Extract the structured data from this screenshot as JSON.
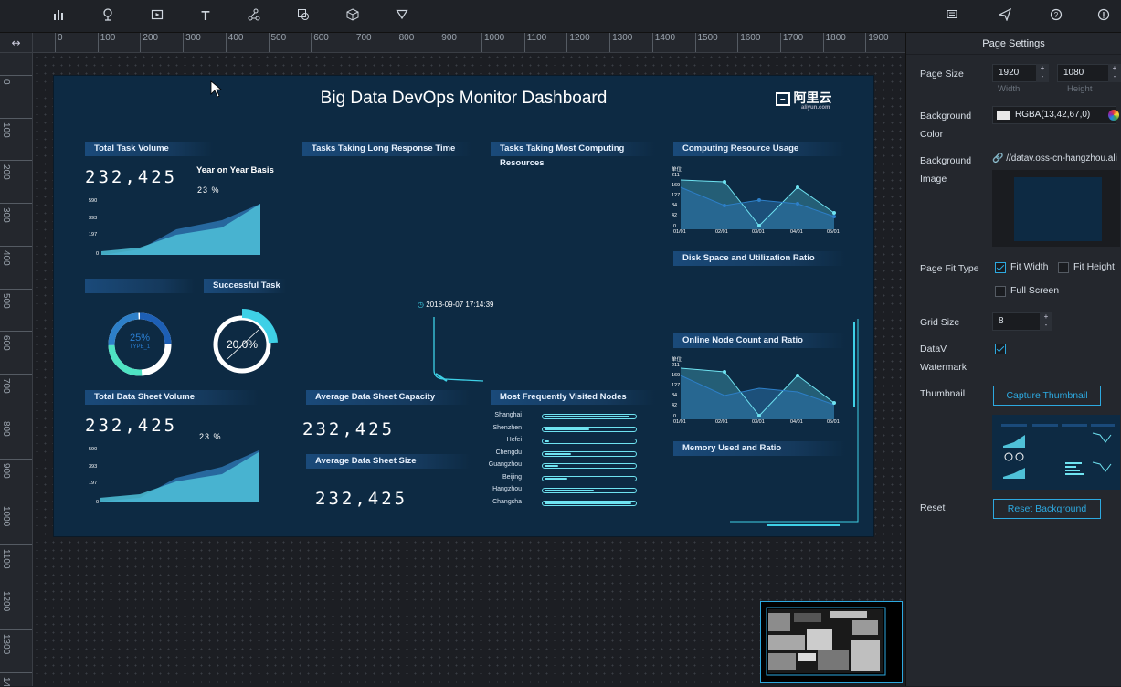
{
  "toolbar": {
    "tools": [
      "chart-icon",
      "map-pin-icon",
      "media-icon",
      "text-icon",
      "network-icon",
      "layers-icon",
      "cube-icon",
      "filter-icon"
    ],
    "right_tools": [
      "comment-icon",
      "publish-icon",
      "help-icon",
      "info-icon"
    ],
    "text_tool_label": "T"
  },
  "ruler": {
    "h_labels": [
      "0",
      "100",
      "200",
      "300",
      "400",
      "500",
      "600",
      "700",
      "800",
      "900",
      "1000",
      "1100",
      "1200",
      "1300",
      "1400",
      "1500",
      "1600",
      "1700",
      "1800",
      "1900"
    ],
    "v_labels": [
      "0",
      "100",
      "200",
      "300",
      "400",
      "500",
      "600",
      "700",
      "800",
      "900",
      "1000",
      "1100",
      "1200",
      "1300",
      "14"
    ]
  },
  "dashboard": {
    "title": "Big Data DevOps Monitor Dashboard",
    "logo_text": "阿里云",
    "logo_sub": "aliyun.com",
    "panels": {
      "total_task": "Total Task Volume",
      "long_response": "Tasks Taking Long Response Time",
      "most_computing": "Tasks Taking Most Computing Resources",
      "computing_usage": "Computing Resource Usage",
      "disk_space": "Disk Space and Utilization Ratio",
      "successful_task": "Successful Task",
      "online_node": "Online Node Count and Ratio",
      "total_sheet": "Total Data Sheet Volume",
      "avg_capacity": "Average Data Sheet Capacity",
      "most_visited": "Most Frequently Visited Nodes",
      "memory": "Memory Used and Ratio",
      "avg_size": "Average Data Sheet Size"
    },
    "total_task_value": "232,425",
    "yoy_label": "Year on Year Basis",
    "yoy_value": "23 %",
    "total_sheet_value": "232,425",
    "sheet_pct": "23 %",
    "avg_capacity_value": "232,425",
    "avg_size_value": "232,425",
    "area_ticks": [
      "590",
      "393",
      "197",
      "0"
    ],
    "donut1_value": "25%",
    "donut1_type": "TYPE_1",
    "donut2_value": "20.0%",
    "timestamp": "2018-09-07 17:14:39",
    "line_unit": "单位",
    "line_ticks": [
      "211",
      "169",
      "127",
      "84",
      "42",
      "0"
    ],
    "line_x": [
      "01/01",
      "02/01",
      "03/01",
      "04/01",
      "05/01"
    ],
    "nodes": [
      {
        "name": "Shanghai",
        "ratio": 0.95
      },
      {
        "name": "Shenzhen",
        "ratio": 0.5
      },
      {
        "name": "Hefei",
        "ratio": 0.05
      },
      {
        "name": "Chengdu",
        "ratio": 0.3
      },
      {
        "name": "Guangzhou",
        "ratio": 0.15
      },
      {
        "name": "Beijing",
        "ratio": 0.25
      },
      {
        "name": "Hangzhou",
        "ratio": 0.55
      },
      {
        "name": "Changsha",
        "ratio": 0.97
      }
    ]
  },
  "settings": {
    "header": "Page Settings",
    "page_size_label": "Page Size",
    "width_value": "1920",
    "height_value": "1080",
    "width_caption": "Width",
    "height_caption": "Height",
    "bg_color_label": "Background",
    "bg_color_label2": "Color",
    "bg_color_value": "RGBA(13,42,67,0)",
    "bg_image_label": "Background",
    "bg_image_label2": "Image",
    "bg_image_url": "//datav.oss-cn-hangzhou.ali",
    "fit_label": "Page Fit Type",
    "fit_width": "Fit Width",
    "fit_height": "Fit Height",
    "full_screen": "Full Screen",
    "fit_width_checked": true,
    "fit_height_checked": false,
    "full_screen_checked": false,
    "grid_label": "Grid Size",
    "grid_value": "8",
    "watermark_label": "DataV",
    "watermark_label2": "Watermark",
    "watermark_checked": true,
    "thumbnail_label": "Thumbnail",
    "capture_button": "Capture Thumbnail",
    "reset_label": "Reset",
    "reset_button": "Reset Background"
  },
  "colors": {
    "accent": "#2da9e0",
    "canvas_bg": "#0d2a43",
    "cyan": "#6fe3f1"
  }
}
